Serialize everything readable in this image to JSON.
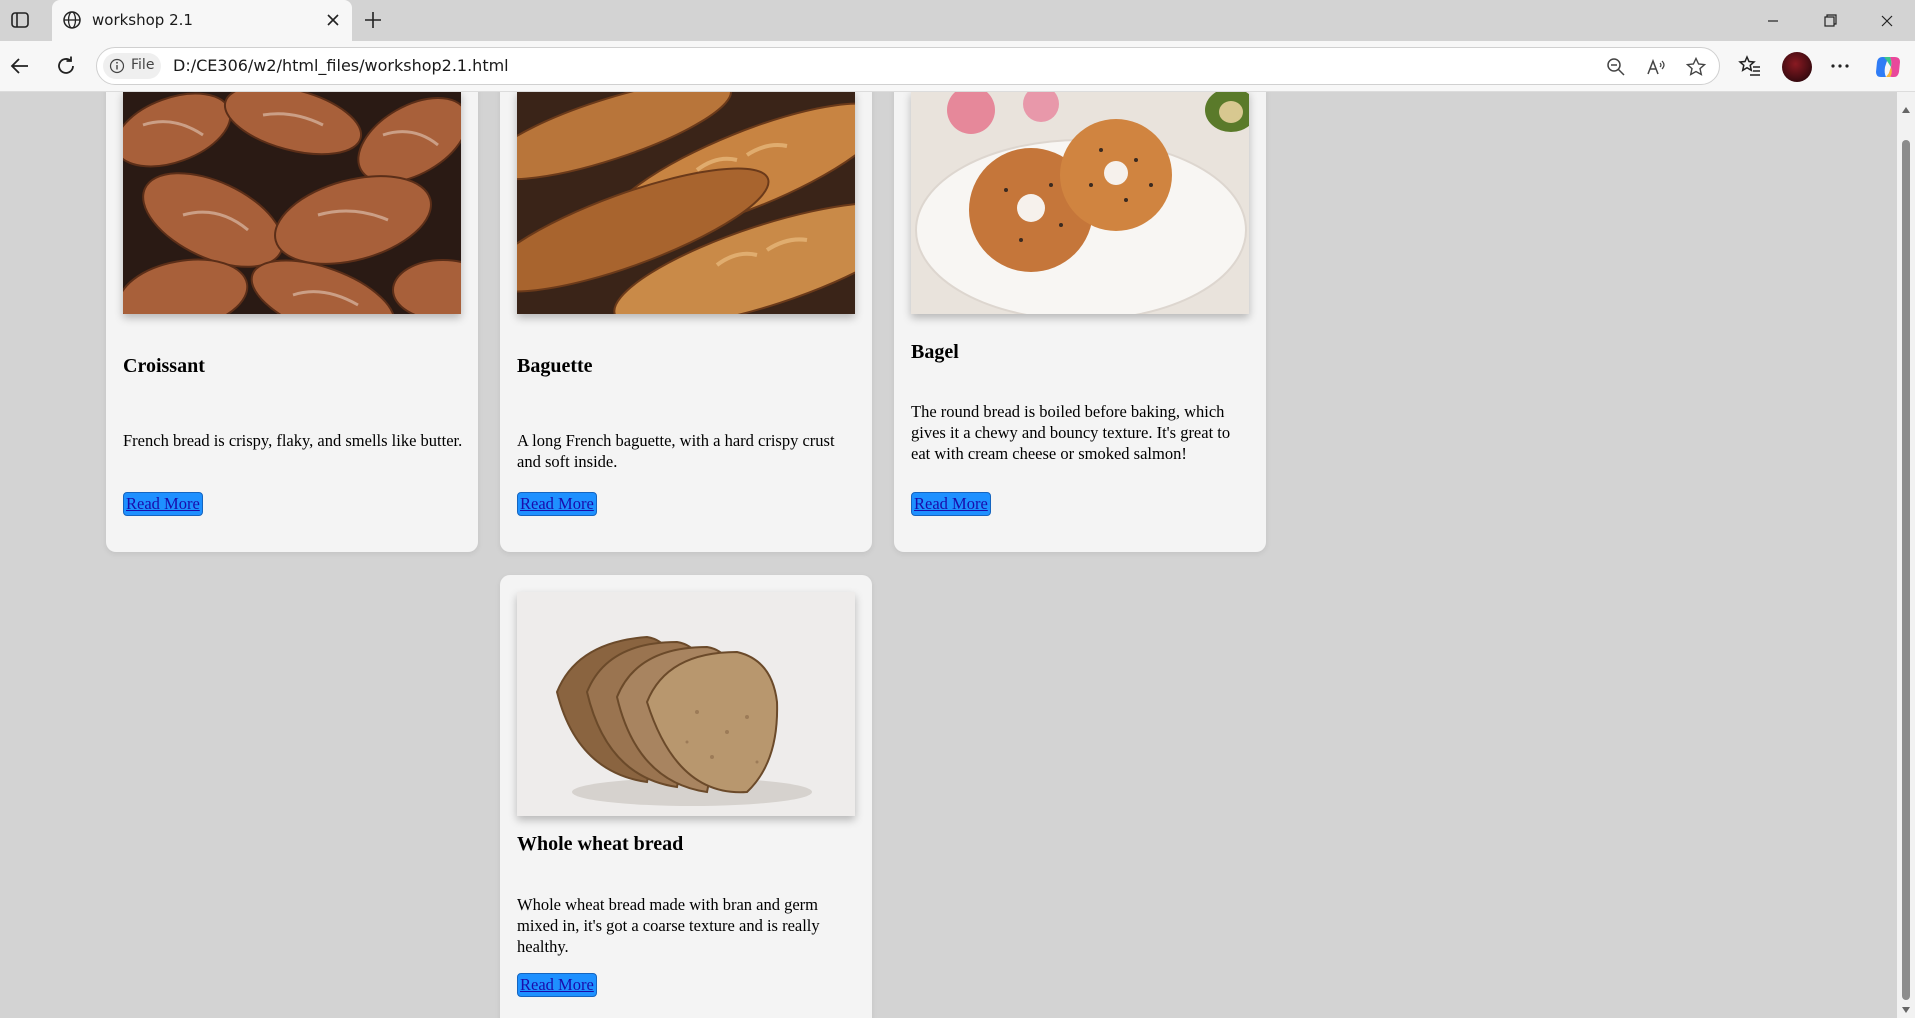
{
  "browser": {
    "tab_title": "workshop 2.1",
    "file_label": "File",
    "url": "D:/CE306/w2/html_files/workshop2.1.html"
  },
  "cards": [
    {
      "title": "Croissant",
      "description": "French bread is crispy, flaky, and smells like butter.",
      "button": "Read More",
      "image": "croissant-photo"
    },
    {
      "title": "Baguette",
      "description": "A long French baguette, with a hard crispy crust and soft inside.",
      "button": "Read More",
      "image": "baguette-photo"
    },
    {
      "title": "Bagel",
      "description": "The round bread is boiled before baking, which gives it a chewy and bouncy texture. It's great to eat with cream cheese or smoked salmon!",
      "button": "Read More",
      "image": "bagel-photo"
    },
    {
      "title": "Whole wheat bread",
      "description": "Whole wheat bread made with bran and germ mixed in, it's got a coarse texture and is really healthy.",
      "button": "Read More",
      "image": "whole-wheat-bread-photo"
    }
  ],
  "colors": {
    "page_bg": "#d3d3d3",
    "card_bg": "#f4f4f4",
    "button_bg": "#1e90ff"
  }
}
